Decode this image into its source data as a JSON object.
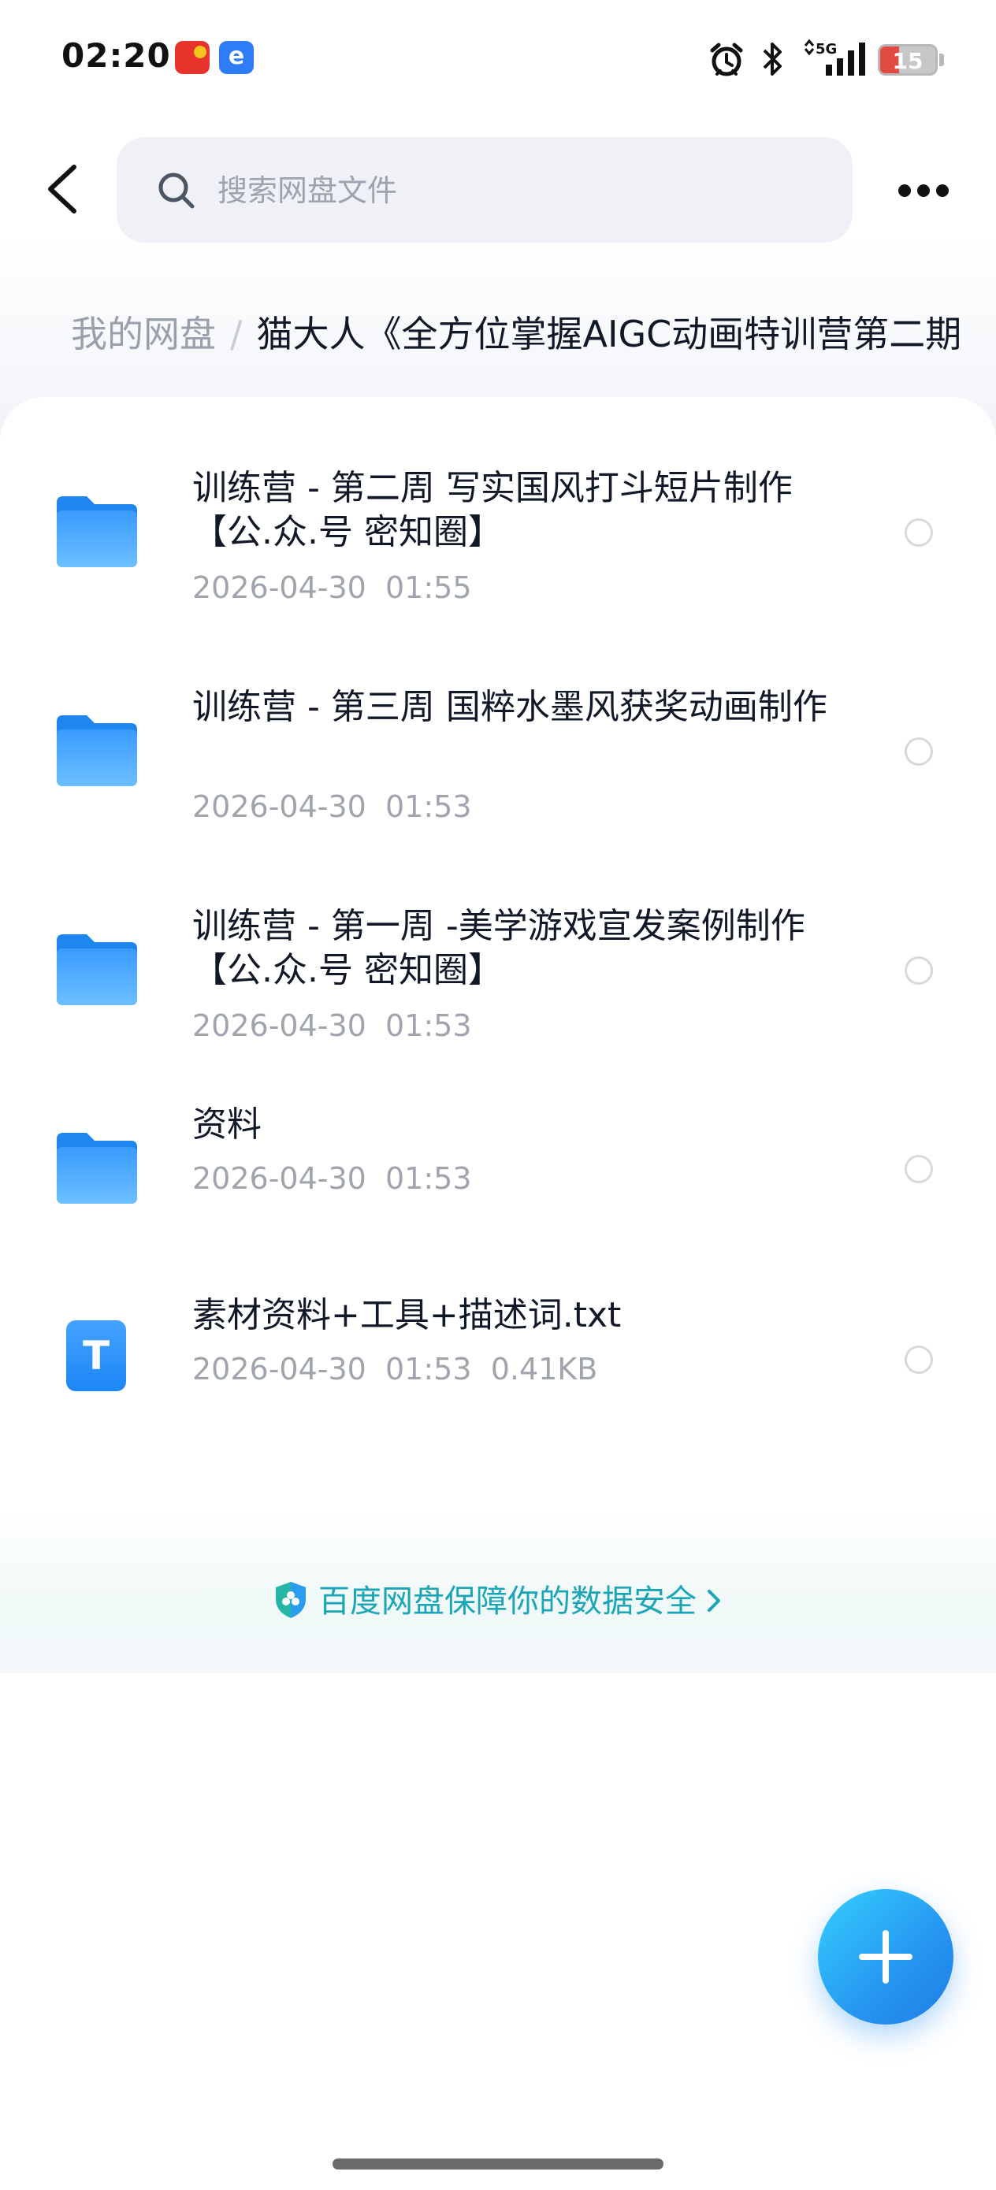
{
  "status_bar": {
    "time": "02:20",
    "network": "5G",
    "battery": "15",
    "icons": [
      "alarm-icon",
      "bluetooth-icon",
      "signal-icon"
    ]
  },
  "header": {
    "search_placeholder": "搜索网盘文件"
  },
  "breadcrumb": {
    "root": "我的网盘",
    "separator": "/",
    "current": "猫大人《全方位掌握AIGC动画特训营第二期"
  },
  "files": [
    {
      "type": "folder",
      "name": "训练营 - 第二周 写实国风打斗短片制作【公.众.号 密知圈】",
      "date": "2026-04-30  01:55",
      "size": ""
    },
    {
      "type": "folder",
      "name": "训练营 - 第三周 国粹水墨风获奖动画制作",
      "date": "2026-04-30  01:53",
      "size": ""
    },
    {
      "type": "folder",
      "name": "训练营 - 第一周 -美学游戏宣发案例制作【公.众.号 密知圈】",
      "date": "2026-04-30  01:53",
      "size": ""
    },
    {
      "type": "folder",
      "name": "资料",
      "date": "2026-04-30  01:53",
      "size": ""
    },
    {
      "type": "txt",
      "name": "素材资料+工具+描述词.txt",
      "date": "2026-04-30  01:53",
      "size": "0.41KB",
      "icon_letter": "T"
    }
  ],
  "security": {
    "text": "百度网盘保障你的数据安全",
    "color": "#1aa6b7"
  },
  "colors": {
    "accent": "#2696f0",
    "folder": "#4aa8ff"
  }
}
